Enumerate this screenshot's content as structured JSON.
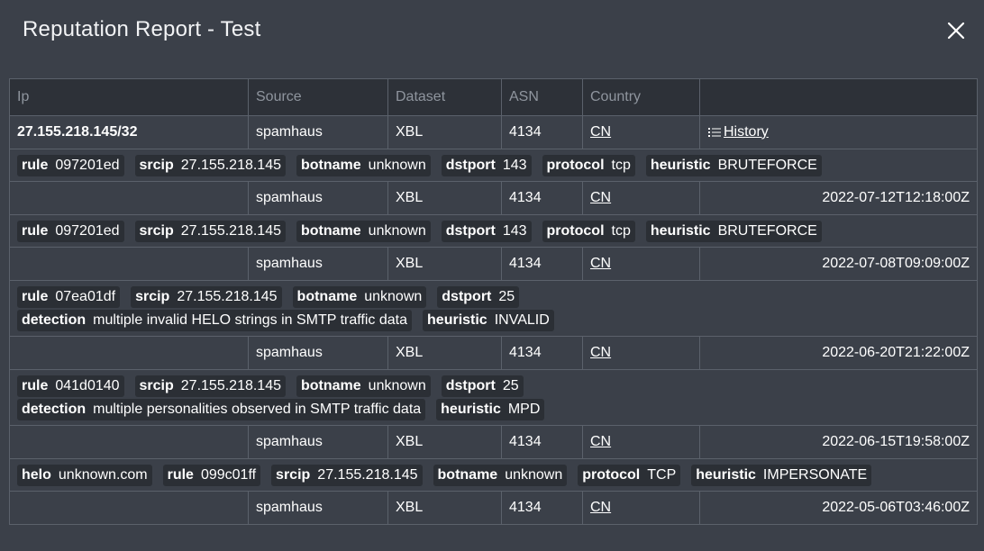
{
  "modal": {
    "title": "Reputation Report - Test",
    "close_icon": "close-icon"
  },
  "columns": [
    "Ip",
    "Source",
    "Dataset",
    "ASN",
    "Country",
    ""
  ],
  "summary": {
    "ip": "27.155.218.145/32",
    "source": "spamhaus",
    "dataset": "XBL",
    "asn": "4134",
    "country": "CN",
    "history_label": "History",
    "history_icon": "list-icon"
  },
  "entries": [
    {
      "tag_lines": [
        [
          {
            "k": "rule",
            "v": "097201ed"
          },
          {
            "k": "srcip",
            "v": "27.155.218.145"
          },
          {
            "k": "botname",
            "v": "unknown"
          },
          {
            "k": "dstport",
            "v": "143"
          },
          {
            "k": "protocol",
            "v": "tcp"
          },
          {
            "k": "heuristic",
            "v": "BRUTEFORCE"
          }
        ]
      ],
      "source": "spamhaus",
      "dataset": "XBL",
      "asn": "4134",
      "country": "CN",
      "date": "2022-07-12T12:18:00Z"
    },
    {
      "tag_lines": [
        [
          {
            "k": "rule",
            "v": "097201ed"
          },
          {
            "k": "srcip",
            "v": "27.155.218.145"
          },
          {
            "k": "botname",
            "v": "unknown"
          },
          {
            "k": "dstport",
            "v": "143"
          },
          {
            "k": "protocol",
            "v": "tcp"
          },
          {
            "k": "heuristic",
            "v": "BRUTEFORCE"
          }
        ]
      ],
      "source": "spamhaus",
      "dataset": "XBL",
      "asn": "4134",
      "country": "CN",
      "date": "2022-07-08T09:09:00Z"
    },
    {
      "tag_lines": [
        [
          {
            "k": "rule",
            "v": "07ea01df"
          },
          {
            "k": "srcip",
            "v": "27.155.218.145"
          },
          {
            "k": "botname",
            "v": "unknown"
          },
          {
            "k": "dstport",
            "v": "25"
          }
        ],
        [
          {
            "k": "detection",
            "v": "multiple invalid HELO strings in SMTP traffic data"
          },
          {
            "k": "heuristic",
            "v": "INVALID"
          }
        ]
      ],
      "source": "spamhaus",
      "dataset": "XBL",
      "asn": "4134",
      "country": "CN",
      "date": "2022-06-20T21:22:00Z"
    },
    {
      "tag_lines": [
        [
          {
            "k": "rule",
            "v": "041d0140"
          },
          {
            "k": "srcip",
            "v": "27.155.218.145"
          },
          {
            "k": "botname",
            "v": "unknown"
          },
          {
            "k": "dstport",
            "v": "25"
          }
        ],
        [
          {
            "k": "detection",
            "v": "multiple personalities observed in SMTP traffic data"
          },
          {
            "k": "heuristic",
            "v": "MPD"
          }
        ]
      ],
      "source": "spamhaus",
      "dataset": "XBL",
      "asn": "4134",
      "country": "CN",
      "date": "2022-06-15T19:58:00Z"
    },
    {
      "tag_lines": [
        [
          {
            "k": "helo",
            "v": "unknown.com"
          },
          {
            "k": "rule",
            "v": "099c01ff"
          },
          {
            "k": "srcip",
            "v": "27.155.218.145"
          },
          {
            "k": "botname",
            "v": "unknown"
          },
          {
            "k": "protocol",
            "v": "TCP"
          },
          {
            "k": "heuristic",
            "v": "IMPERSONATE"
          }
        ]
      ],
      "source": "spamhaus",
      "dataset": "XBL",
      "asn": "4134",
      "country": "CN",
      "date": "2022-05-06T03:46:00Z"
    }
  ]
}
